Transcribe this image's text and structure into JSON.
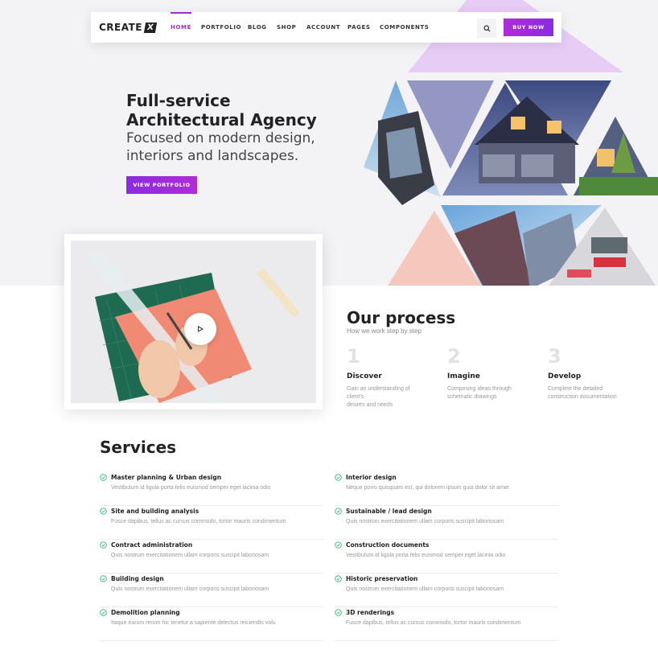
{
  "brand": {
    "name": "CREATE",
    "mark": "X"
  },
  "nav": {
    "items": [
      "HOME",
      "PORTFOLIO",
      "BLOG",
      "SHOP",
      "ACCOUNT",
      "PAGES",
      "COMPONENTS"
    ],
    "active": "HOME",
    "buy_label": "BUY NOW",
    "search_icon": "search-icon"
  },
  "hero": {
    "title_line1": "Full-service",
    "title_line2": "Architectural Agency",
    "subtitle_line1": "Focused on modern design,",
    "subtitle_line2": "interiors and landscapes.",
    "cta_label": "VIEW PORTFOLIO"
  },
  "video": {
    "play_icon": "play-icon"
  },
  "process": {
    "title": "Our process",
    "subtitle": "How we work step by step",
    "steps": [
      {
        "num": "1",
        "title": "Discover",
        "desc_line1": "Gain an understanding of client's",
        "desc_line2": "desires and needs"
      },
      {
        "num": "2",
        "title": "Imagine",
        "desc_line1": "Composing ideas through",
        "desc_line2": "schematic drawings"
      },
      {
        "num": "3",
        "title": "Develop",
        "desc_line1": "Complete the detailed",
        "desc_line2": "construction documentation"
      }
    ]
  },
  "services": {
    "title": "Services",
    "items": [
      {
        "name": "Master planning & Urban design",
        "desc": "Vestibulum id ligula porta felis euismod semper eget lacinia odio"
      },
      {
        "name": "Interior design",
        "desc": "Neque porro quisquam est, qui dolorem ipsum quia dolor sit amet"
      },
      {
        "name": "Site and building analysis",
        "desc": "Fusce dapibus, tellus ac cursus commodo, tortor mauris condimentum"
      },
      {
        "name": "Sustainable / lead design",
        "desc": "Quis nostrum exercitationem ullam corporis suscipit laboriosam"
      },
      {
        "name": "Contract administration",
        "desc": "Quis nostrum exercitationem ullam corporis suscipit laboriosam"
      },
      {
        "name": "Construction documents",
        "desc": "Vestibulum id ligula porta felis euismod semper eget lacinia odio"
      },
      {
        "name": "Building design",
        "desc": "Quis nostrum exercitationem ullam corporis suscipit laboriosam"
      },
      {
        "name": "Historic preservation",
        "desc": "Quis nostrum exercitationem ullam corporis suscipit laboriosam"
      },
      {
        "name": "Demolition planning",
        "desc": "Itaque earum rerum hic tenetur a sapiente delectus reiciendis volu"
      },
      {
        "name": "3D renderings",
        "desc": "Fusce dapibus, tellus ac cursus commodo, tortor mauris condimentum"
      }
    ]
  },
  "colors": {
    "accent": "#a32bd6",
    "check": "#3fbf7f",
    "lavender": "#e7cdf6",
    "peach": "#f6c7bd",
    "slate_purple": "#9496c4"
  }
}
